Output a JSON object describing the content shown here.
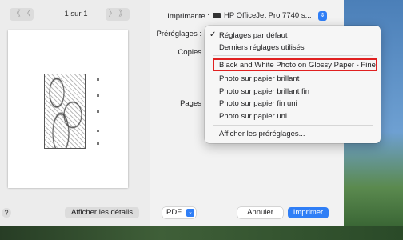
{
  "preview": {
    "page_indicator": "1 sur 1",
    "prev_label": "《 〈",
    "next_label": "〉 》",
    "details_button": "Afficher les détails",
    "help_label": "?"
  },
  "settings": {
    "printer_label": "Imprimante :",
    "printer_value": "HP OfficeJet Pro 7740 s...",
    "presets_label": "Préréglages :",
    "copies_label": "Copies",
    "pages_label": "Pages"
  },
  "presets_menu": {
    "items": [
      "Réglages par défaut",
      "Derniers réglages utilisés",
      "Black and White Photo on Glossy Paper - Fine",
      "Photo sur papier brillant",
      "Photo sur papier brillant fin",
      "Photo sur papier fin uni",
      "Photo sur papier uni",
      "Afficher les préréglages..."
    ],
    "checked_index": 0
  },
  "footer": {
    "pdf_label": "PDF",
    "cancel_label": "Annuler",
    "print_label": "Imprimer"
  },
  "colors": {
    "accent": "#2f7ef6",
    "highlight_border": "#e02020"
  }
}
